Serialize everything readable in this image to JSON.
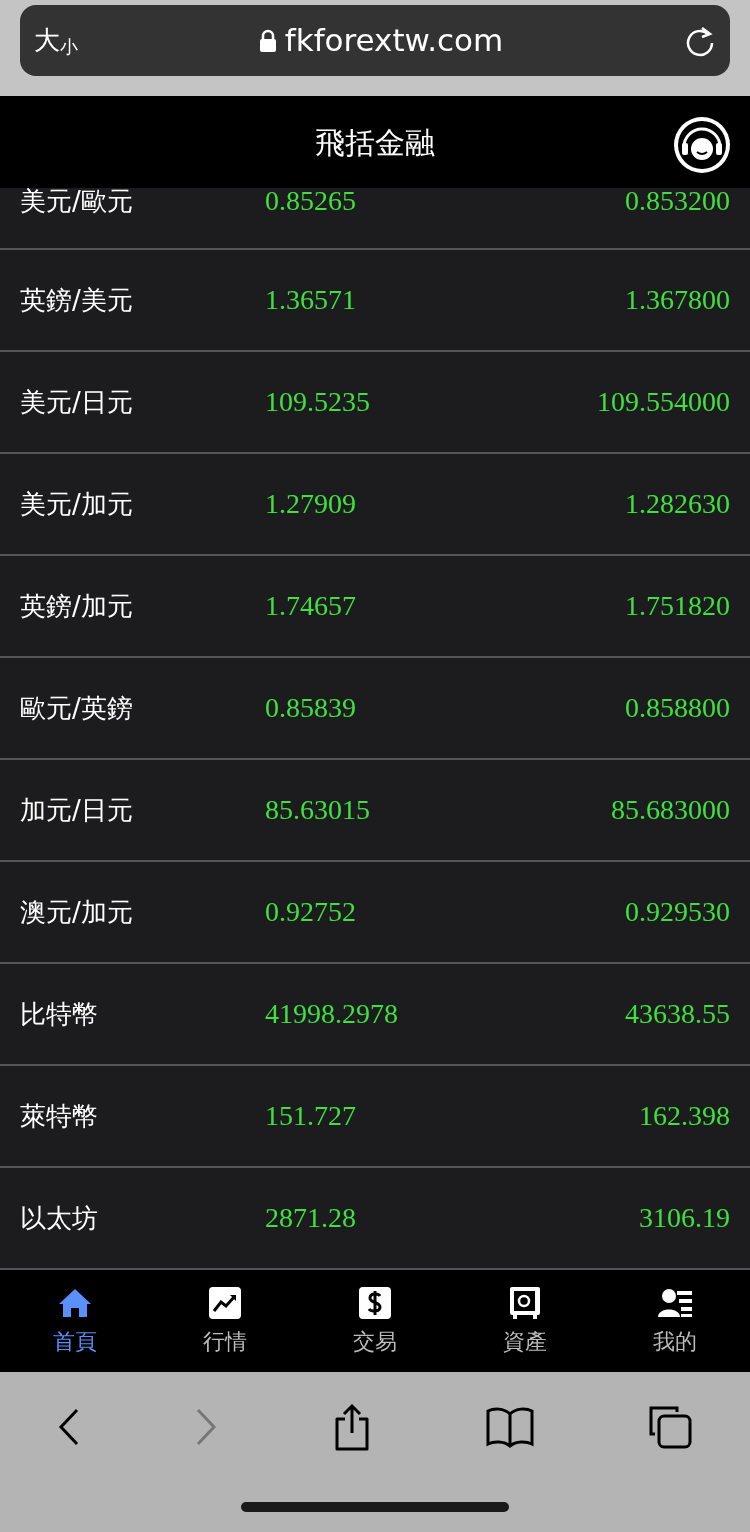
{
  "browser": {
    "text_size_label": "大",
    "text_size_small": "小",
    "url": "fkforextw.com"
  },
  "header": {
    "title": "飛括金融"
  },
  "rates": [
    {
      "pair": "美元/歐元",
      "bid": "0.85265",
      "ask": "0.853200"
    },
    {
      "pair": "英鎊/美元",
      "bid": "1.36571",
      "ask": "1.367800"
    },
    {
      "pair": "美元/日元",
      "bid": "109.5235",
      "ask": "109.554000"
    },
    {
      "pair": "美元/加元",
      "bid": "1.27909",
      "ask": "1.282630"
    },
    {
      "pair": "英鎊/加元",
      "bid": "1.74657",
      "ask": "1.751820"
    },
    {
      "pair": "歐元/英鎊",
      "bid": "0.85839",
      "ask": "0.858800"
    },
    {
      "pair": "加元/日元",
      "bid": "85.63015",
      "ask": "85.683000"
    },
    {
      "pair": "澳元/加元",
      "bid": "0.92752",
      "ask": "0.929530"
    },
    {
      "pair": "比特幣",
      "bid": "41998.2978",
      "ask": "43638.55"
    },
    {
      "pair": "萊特幣",
      "bid": "151.727",
      "ask": "162.398"
    },
    {
      "pair": "以太坊",
      "bid": "2871.28",
      "ask": "3106.19"
    }
  ],
  "nav": [
    {
      "label": "首頁",
      "kind": "home",
      "selected": true
    },
    {
      "label": "行情",
      "kind": "market",
      "selected": false
    },
    {
      "label": "交易",
      "kind": "trade",
      "selected": false
    },
    {
      "label": "資產",
      "kind": "assets",
      "selected": false
    },
    {
      "label": "我的",
      "kind": "profile",
      "selected": false
    }
  ],
  "toolbar": {
    "back_disabled": false,
    "forward_disabled": true
  }
}
